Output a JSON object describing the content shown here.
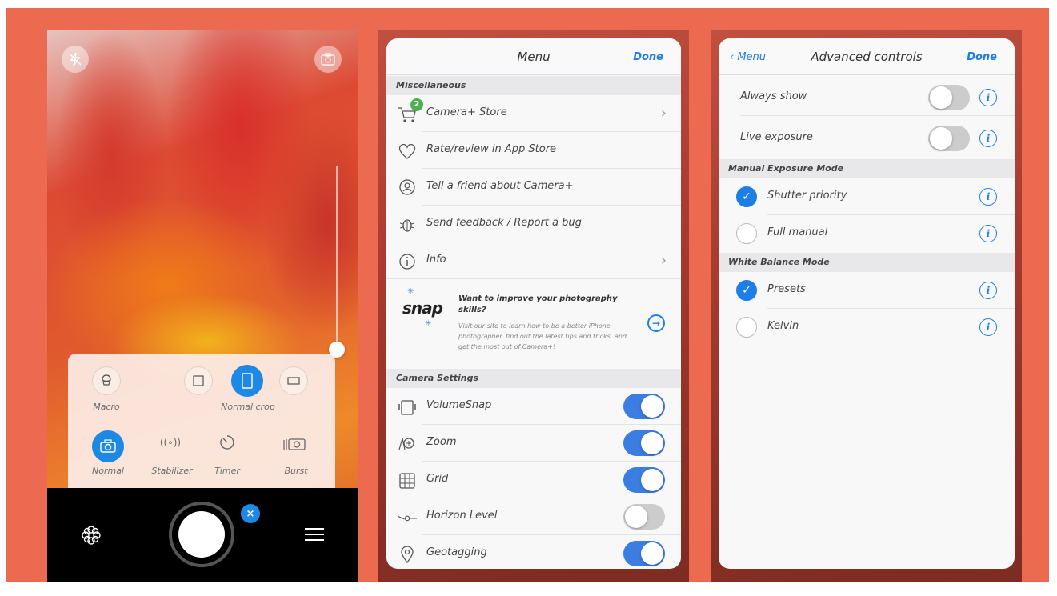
{
  "camera": {
    "modes_top": [
      {
        "label": "Macro"
      },
      {
        "label": "Normal crop"
      }
    ],
    "modes_bottom": [
      {
        "label": "Normal"
      },
      {
        "label": "Stabilizer"
      },
      {
        "label": "Timer"
      },
      {
        "label": "Burst"
      }
    ],
    "close_badge": "×",
    "accent_color": "#1e88e5"
  },
  "menu": {
    "title": "Menu",
    "done_label": "Done",
    "section_misc": "Miscellaneous",
    "store_badge": "2",
    "items": [
      {
        "label": "Camera+ Store"
      },
      {
        "label": "Rate/review in App Store"
      },
      {
        "label": "Tell a friend about Camera+"
      },
      {
        "label": "Send feedback / Report a bug"
      },
      {
        "label": "Info"
      }
    ],
    "promo": {
      "logo": "snap",
      "title": "Want to improve your photography skills?",
      "body": "Visit our site to learn how to be a better iPhone photographer, find out the latest tips and tricks, and get the most out of Camera+!"
    },
    "section_camera": "Camera Settings",
    "settings": [
      {
        "label": "VolumeSnap",
        "on": true
      },
      {
        "label": "Zoom",
        "on": true
      },
      {
        "label": "Grid",
        "on": true
      },
      {
        "label": "Horizon Level",
        "on": false
      },
      {
        "label": "Geotagging",
        "on": true
      }
    ]
  },
  "advanced": {
    "back_label": "Menu",
    "title": "Advanced controls",
    "done_label": "Done",
    "toggles": [
      {
        "label": "Always show",
        "on": false
      },
      {
        "label": "Live exposure",
        "on": false
      }
    ],
    "section_exposure": "Manual Exposure Mode",
    "exposure_options": [
      {
        "label": "Shutter priority",
        "checked": true
      },
      {
        "label": "Full manual",
        "checked": false
      }
    ],
    "section_wb": "White Balance Mode",
    "wb_options": [
      {
        "label": "Presets",
        "checked": true
      },
      {
        "label": "Kelvin",
        "checked": false
      }
    ]
  }
}
